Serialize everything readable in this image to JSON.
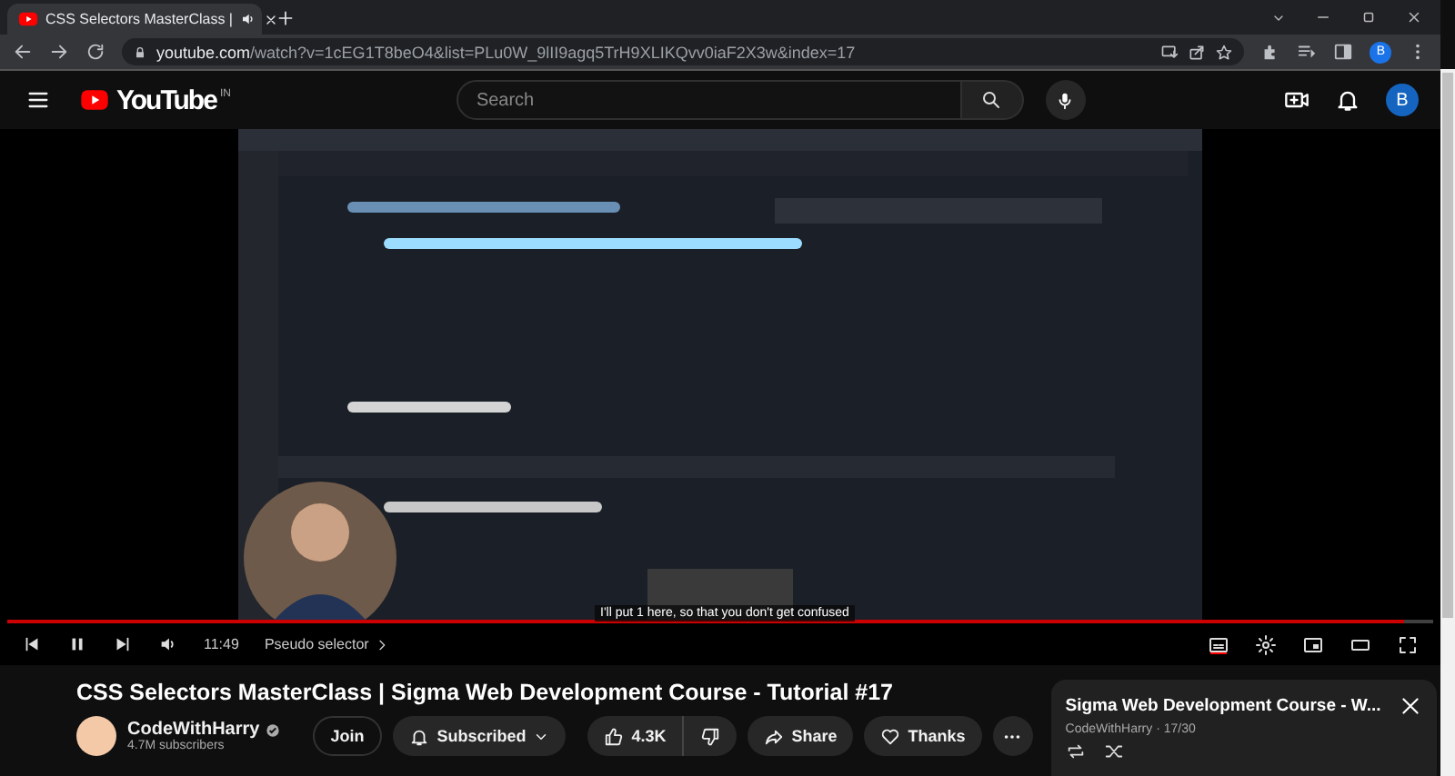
{
  "browser": {
    "tab": {
      "title": "CSS Selectors MasterClass |"
    },
    "url": {
      "host": "youtube.com",
      "path": "/watch?v=1cEG1T8beO4&list=PLu0W_9lII9agq5TrH9XLIKQvv0iaF2X3w&index=17"
    },
    "profile_initial": "B"
  },
  "header": {
    "logo": "YouTube",
    "region": "IN",
    "search": {
      "placeholder": "Search"
    },
    "avatar_initial": "B"
  },
  "player": {
    "caption": "I'll put 1 here, so that you don't get confused",
    "progress": {
      "level": 0.98
    },
    "time": "11:49",
    "chapter": "Pseudo selector"
  },
  "video": {
    "title": "CSS Selectors MasterClass | Sigma Web Development Course - Tutorial #17",
    "channel": {
      "name": "CodeWithHarry",
      "subscribers": "4.7M subscribers"
    },
    "join": "Join",
    "subscribe": "Subscribed",
    "likes": "4.3K",
    "share": "Share",
    "thanks": "Thanks"
  },
  "playlist": {
    "title": "Sigma Web Development Course - W...",
    "channel": "CodeWithHarry",
    "separator": "·",
    "position": "17/30"
  }
}
